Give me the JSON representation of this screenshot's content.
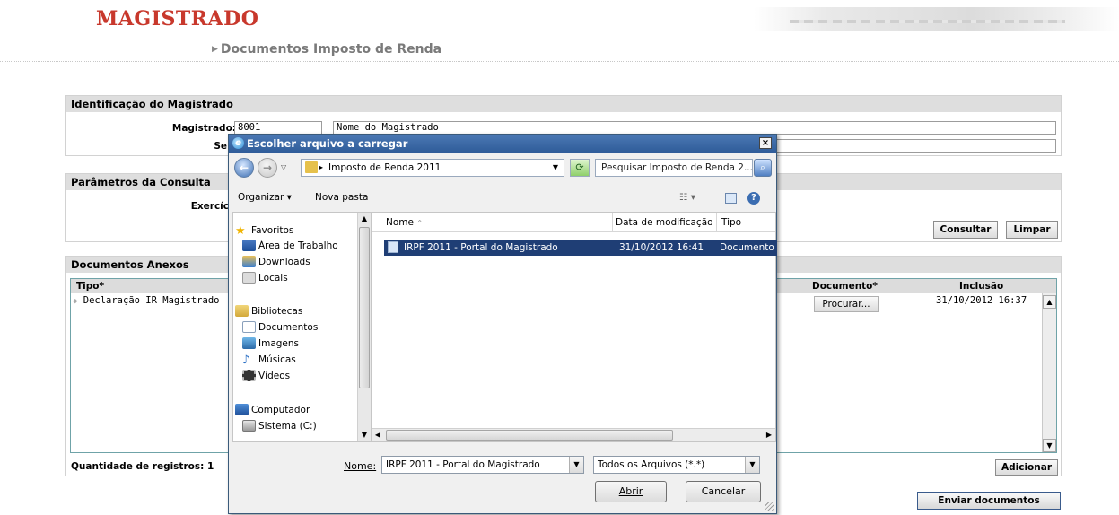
{
  "header": {
    "brand": "MAGISTRADO",
    "breadcrumb": "Documentos Imposto de Renda"
  },
  "panels": {
    "identificacao": {
      "title": "Identificação do Magistrado",
      "magistrado_label": "Magistrado:",
      "magistrado_code": "8001",
      "magistrado_name": "Nome do Magistrado",
      "second_label_partial": "Se"
    },
    "parametros": {
      "title": "Parâmetros da Consulta",
      "exercicio_label_partial": "Exercíc",
      "consultar_button": "Consultar",
      "limpar_button": "Limpar"
    },
    "documentos": {
      "title": "Documentos Anexos",
      "columns": {
        "tipo": "Tipo*",
        "documento": "Documento*",
        "inclusao": "Inclusão"
      },
      "rows": [
        {
          "tipo": "Declaração IR Magistrado",
          "documento_button": "Procurar...",
          "inclusao": "31/10/2012 16:37"
        }
      ],
      "quantidade": "Quantidade de registros: 1",
      "adicionar_button": "Adicionar"
    },
    "enviar_button": "Enviar documentos"
  },
  "dialog": {
    "title": "Escolher arquivo a carregar",
    "close_glyph": "×",
    "address": "Imposto de Renda 2011",
    "search_placeholder": "Pesquisar Imposto de Renda 2...",
    "toolbar": {
      "organizar": "Organizar ▾",
      "nova_pasta": "Nova pasta"
    },
    "nav": {
      "favoritos": "Favoritos",
      "area_trabalho": "Área de Trabalho",
      "downloads": "Downloads",
      "locais": "Locais",
      "bibliotecas": "Bibliotecas",
      "documentos": "Documentos",
      "imagens": "Imagens",
      "musicas": "Músicas",
      "videos": "Vídeos",
      "computador": "Computador",
      "sistema": "Sistema (C:)"
    },
    "columns": {
      "nome": "Nome",
      "data": "Data de modificação",
      "tipo": "Tipo"
    },
    "files": [
      {
        "name": "IRPF 2011 - Portal do Magistrado",
        "date": "31/10/2012 16:41",
        "type": "Documento d"
      }
    ],
    "nome_label": "Nome:",
    "nome_value": "IRPF 2011 - Portal do Magistrado",
    "filter_value": "Todos os Arquivos (*.*)",
    "abrir_button": "Abrir",
    "cancelar_button": "Cancelar"
  }
}
